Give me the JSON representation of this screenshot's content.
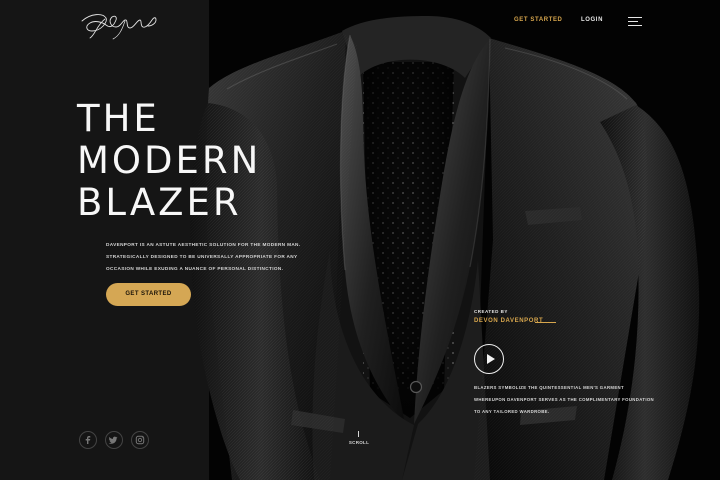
{
  "brand": {
    "logo_text": "Davenport"
  },
  "navigation": {
    "cta_label": "GET STARTED",
    "login_label": "LOGIN"
  },
  "hero": {
    "title_lines": [
      "THE",
      "MODERN",
      "BLAZER"
    ],
    "description": "DAVENPORT IS AN ASTUTE AESTHETIC SOLUTION FOR THE MODERN MAN. STRATEGICALLY DESIGNED TO BE UNIVERSALLY APPROPRIATE FOR ANY OCCASION WHILE EXUDING A NUANCE OF PERSONAL DISTINCTION.",
    "cta_label": "GET STARTED"
  },
  "social": [
    {
      "icon": "facebook-icon",
      "glyph": "f"
    },
    {
      "icon": "twitter-icon",
      "glyph": "t"
    },
    {
      "icon": "instagram-icon",
      "glyph": "ig"
    }
  ],
  "scroll": {
    "label": "SCROLL"
  },
  "feature": {
    "created_by_label": "CREATED BY",
    "creator_name": "DEVON DAVENPORT",
    "description": "BLAZERS SYMBOLIZE THE QUINTESSENTIAL MEN'S GARMENT WHEREUPON DAVENPORT SERVES AS THE COMPLIMENTARY FOUNDATION TO ANY TAILORED WARDROBE."
  },
  "colors": {
    "accent": "#D5A754",
    "background": "#030303",
    "panel": "#151515",
    "text": "#F7F7F7"
  }
}
